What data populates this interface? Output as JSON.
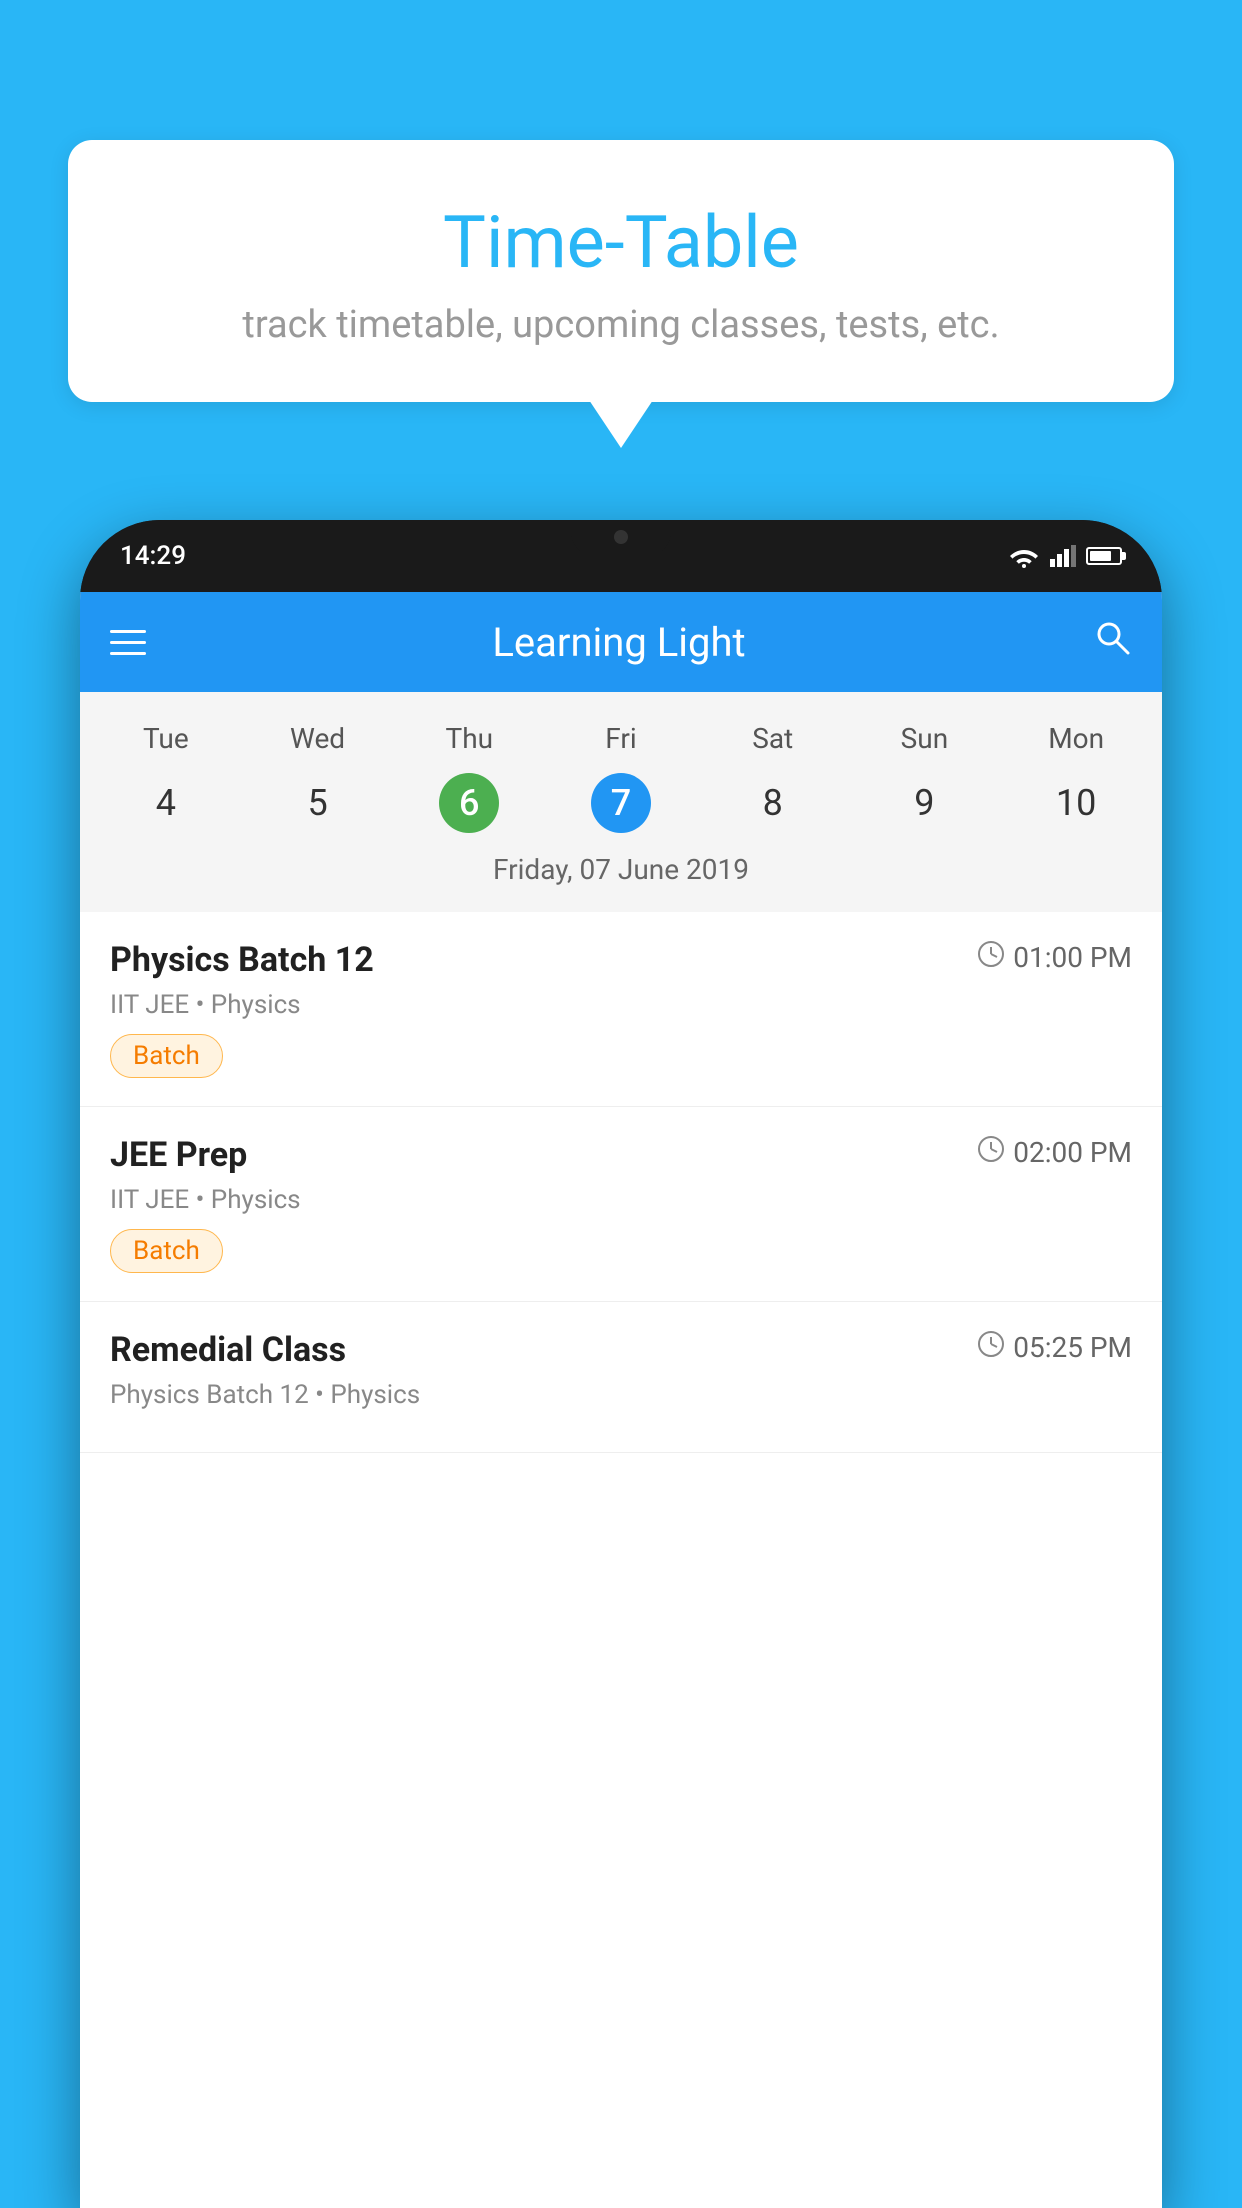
{
  "page": {
    "background_color": "#29b6f6"
  },
  "speech_bubble": {
    "title": "Time-Table",
    "subtitle": "track timetable, upcoming classes, tests, etc."
  },
  "phone": {
    "status_bar": {
      "time": "14:29"
    },
    "app_bar": {
      "title": "Learning Light"
    },
    "calendar": {
      "days": [
        {
          "label": "Tue",
          "number": "4"
        },
        {
          "label": "Wed",
          "number": "5"
        },
        {
          "label": "Thu",
          "number": "6",
          "state": "today"
        },
        {
          "label": "Fri",
          "number": "7",
          "state": "selected"
        },
        {
          "label": "Sat",
          "number": "8"
        },
        {
          "label": "Sun",
          "number": "9"
        },
        {
          "label": "Mon",
          "number": "10"
        }
      ],
      "selected_date_label": "Friday, 07 June 2019"
    },
    "schedule": [
      {
        "title": "Physics Batch 12",
        "time": "01:00 PM",
        "subtitle": "IIT JEE • Physics",
        "badge": "Batch"
      },
      {
        "title": "JEE Prep",
        "time": "02:00 PM",
        "subtitle": "IIT JEE • Physics",
        "badge": "Batch"
      },
      {
        "title": "Remedial Class",
        "time": "05:25 PM",
        "subtitle": "Physics Batch 12 • Physics",
        "badge": null
      }
    ]
  }
}
